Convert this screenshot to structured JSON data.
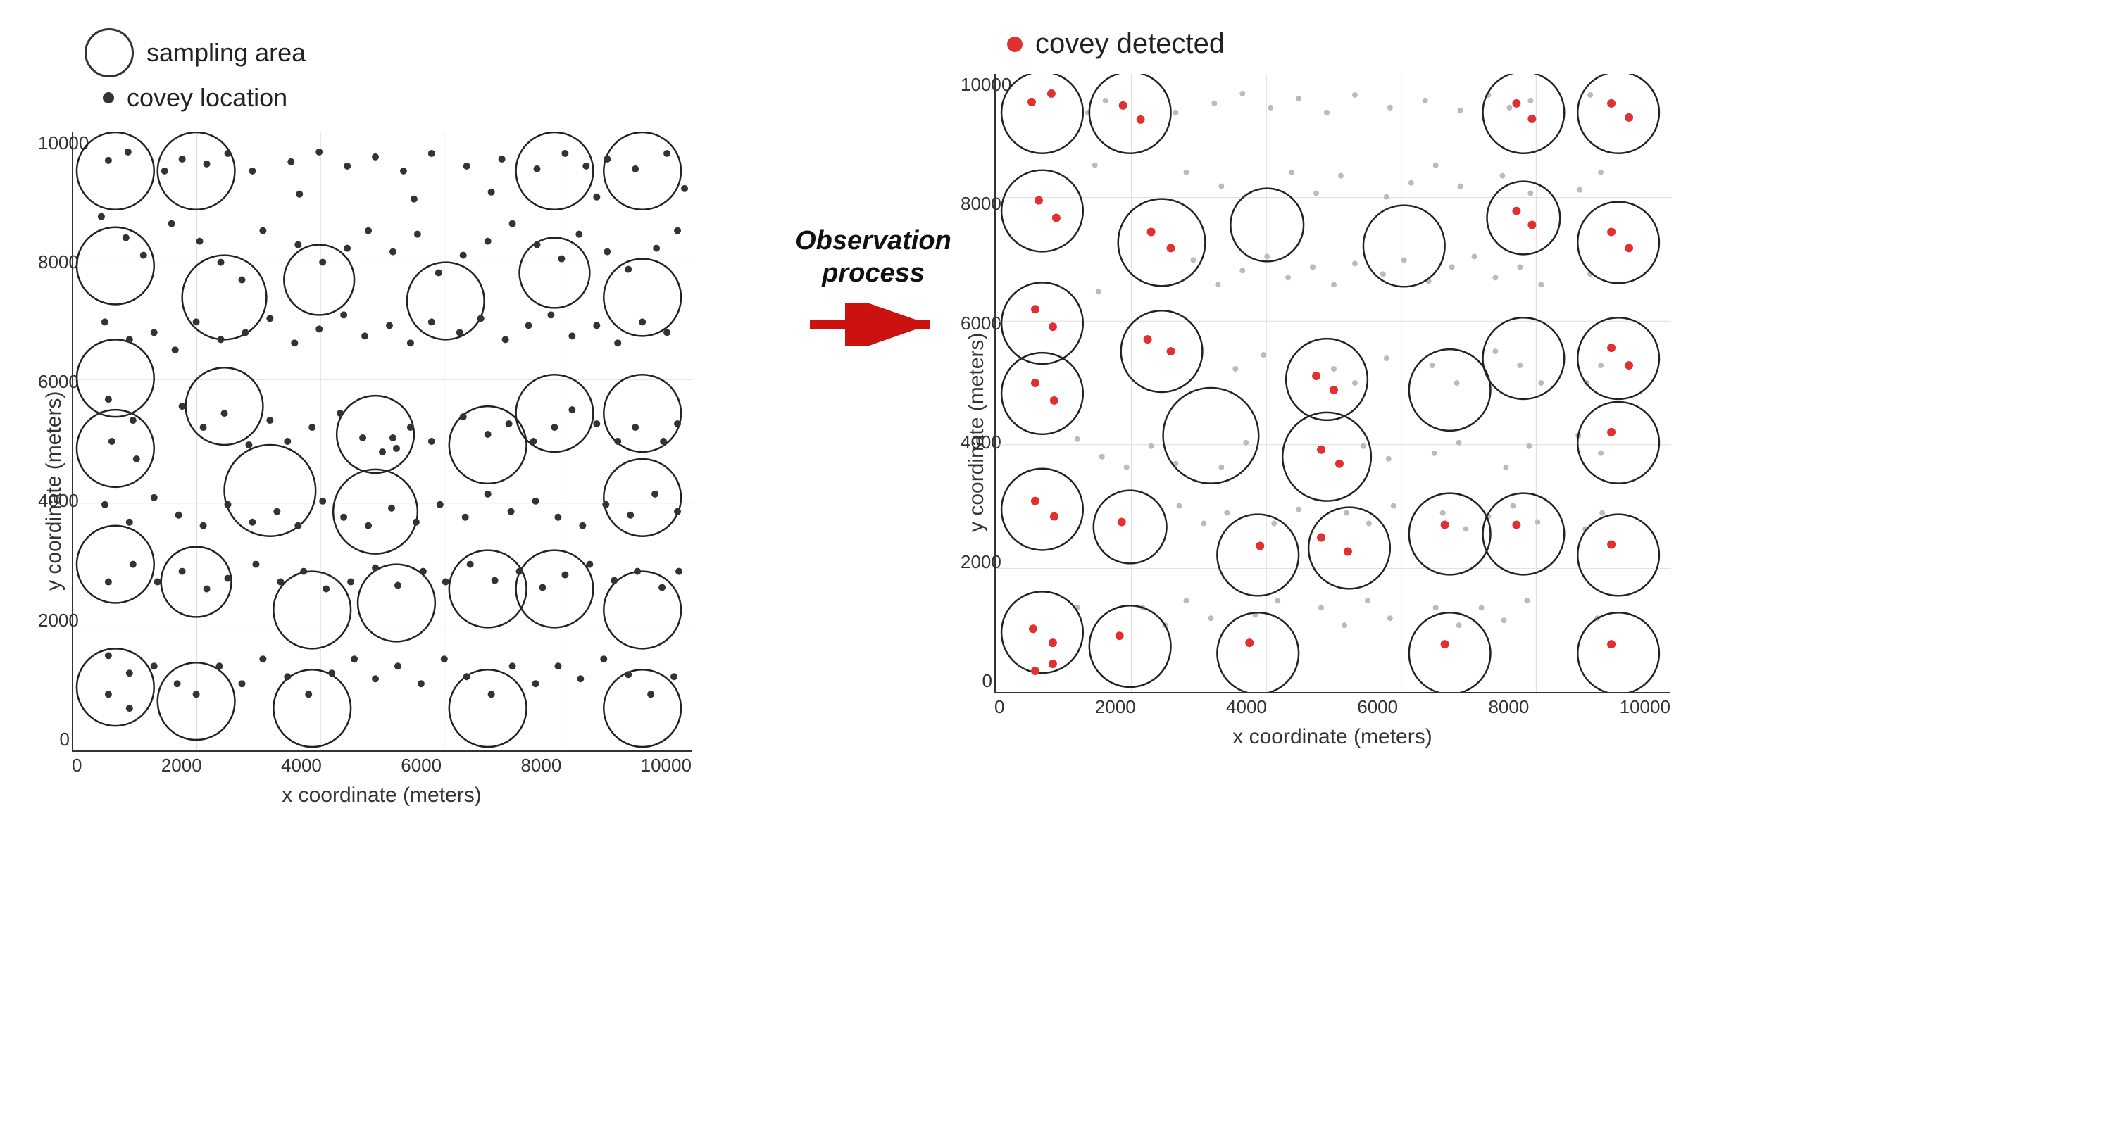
{
  "left_legend": {
    "sampling_area_label": "sampling area",
    "covey_location_label": "covey location"
  },
  "right_legend": {
    "covey_detected_label": "covey detected"
  },
  "observation_process_label": "Observation\nprocess",
  "left_chart": {
    "y_axis_label": "y coordinate (meters)",
    "x_axis_label": "x coordinate (meters)",
    "y_ticks": [
      "0",
      "2000",
      "4000",
      "6000",
      "8000",
      "10000"
    ],
    "x_ticks": [
      "0",
      "2000",
      "4000",
      "6000",
      "8000",
      "10000"
    ]
  },
  "right_chart": {
    "y_axis_label": "y coordinate (meters)",
    "x_axis_label": "x coordinate (meters)",
    "y_ticks": [
      "0",
      "2000",
      "4000",
      "6000",
      "8000",
      "10000"
    ],
    "x_ticks": [
      "0",
      "2000",
      "4000",
      "6000",
      "8000",
      "10000"
    ]
  }
}
